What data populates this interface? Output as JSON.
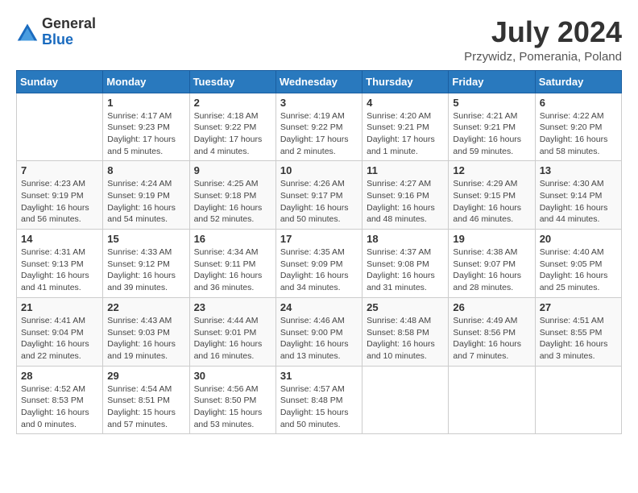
{
  "header": {
    "logo_general": "General",
    "logo_blue": "Blue",
    "month_year": "July 2024",
    "location": "Przywidz, Pomerania, Poland"
  },
  "days_of_week": [
    "Sunday",
    "Monday",
    "Tuesday",
    "Wednesday",
    "Thursday",
    "Friday",
    "Saturday"
  ],
  "weeks": [
    [
      {
        "day": "",
        "info": ""
      },
      {
        "day": "1",
        "info": "Sunrise: 4:17 AM\nSunset: 9:23 PM\nDaylight: 17 hours\nand 5 minutes."
      },
      {
        "day": "2",
        "info": "Sunrise: 4:18 AM\nSunset: 9:22 PM\nDaylight: 17 hours\nand 4 minutes."
      },
      {
        "day": "3",
        "info": "Sunrise: 4:19 AM\nSunset: 9:22 PM\nDaylight: 17 hours\nand 2 minutes."
      },
      {
        "day": "4",
        "info": "Sunrise: 4:20 AM\nSunset: 9:21 PM\nDaylight: 17 hours\nand 1 minute."
      },
      {
        "day": "5",
        "info": "Sunrise: 4:21 AM\nSunset: 9:21 PM\nDaylight: 16 hours\nand 59 minutes."
      },
      {
        "day": "6",
        "info": "Sunrise: 4:22 AM\nSunset: 9:20 PM\nDaylight: 16 hours\nand 58 minutes."
      }
    ],
    [
      {
        "day": "7",
        "info": "Sunrise: 4:23 AM\nSunset: 9:19 PM\nDaylight: 16 hours\nand 56 minutes."
      },
      {
        "day": "8",
        "info": "Sunrise: 4:24 AM\nSunset: 9:19 PM\nDaylight: 16 hours\nand 54 minutes."
      },
      {
        "day": "9",
        "info": "Sunrise: 4:25 AM\nSunset: 9:18 PM\nDaylight: 16 hours\nand 52 minutes."
      },
      {
        "day": "10",
        "info": "Sunrise: 4:26 AM\nSunset: 9:17 PM\nDaylight: 16 hours\nand 50 minutes."
      },
      {
        "day": "11",
        "info": "Sunrise: 4:27 AM\nSunset: 9:16 PM\nDaylight: 16 hours\nand 48 minutes."
      },
      {
        "day": "12",
        "info": "Sunrise: 4:29 AM\nSunset: 9:15 PM\nDaylight: 16 hours\nand 46 minutes."
      },
      {
        "day": "13",
        "info": "Sunrise: 4:30 AM\nSunset: 9:14 PM\nDaylight: 16 hours\nand 44 minutes."
      }
    ],
    [
      {
        "day": "14",
        "info": "Sunrise: 4:31 AM\nSunset: 9:13 PM\nDaylight: 16 hours\nand 41 minutes."
      },
      {
        "day": "15",
        "info": "Sunrise: 4:33 AM\nSunset: 9:12 PM\nDaylight: 16 hours\nand 39 minutes."
      },
      {
        "day": "16",
        "info": "Sunrise: 4:34 AM\nSunset: 9:11 PM\nDaylight: 16 hours\nand 36 minutes."
      },
      {
        "day": "17",
        "info": "Sunrise: 4:35 AM\nSunset: 9:09 PM\nDaylight: 16 hours\nand 34 minutes."
      },
      {
        "day": "18",
        "info": "Sunrise: 4:37 AM\nSunset: 9:08 PM\nDaylight: 16 hours\nand 31 minutes."
      },
      {
        "day": "19",
        "info": "Sunrise: 4:38 AM\nSunset: 9:07 PM\nDaylight: 16 hours\nand 28 minutes."
      },
      {
        "day": "20",
        "info": "Sunrise: 4:40 AM\nSunset: 9:05 PM\nDaylight: 16 hours\nand 25 minutes."
      }
    ],
    [
      {
        "day": "21",
        "info": "Sunrise: 4:41 AM\nSunset: 9:04 PM\nDaylight: 16 hours\nand 22 minutes."
      },
      {
        "day": "22",
        "info": "Sunrise: 4:43 AM\nSunset: 9:03 PM\nDaylight: 16 hours\nand 19 minutes."
      },
      {
        "day": "23",
        "info": "Sunrise: 4:44 AM\nSunset: 9:01 PM\nDaylight: 16 hours\nand 16 minutes."
      },
      {
        "day": "24",
        "info": "Sunrise: 4:46 AM\nSunset: 9:00 PM\nDaylight: 16 hours\nand 13 minutes."
      },
      {
        "day": "25",
        "info": "Sunrise: 4:48 AM\nSunset: 8:58 PM\nDaylight: 16 hours\nand 10 minutes."
      },
      {
        "day": "26",
        "info": "Sunrise: 4:49 AM\nSunset: 8:56 PM\nDaylight: 16 hours\nand 7 minutes."
      },
      {
        "day": "27",
        "info": "Sunrise: 4:51 AM\nSunset: 8:55 PM\nDaylight: 16 hours\nand 3 minutes."
      }
    ],
    [
      {
        "day": "28",
        "info": "Sunrise: 4:52 AM\nSunset: 8:53 PM\nDaylight: 16 hours\nand 0 minutes."
      },
      {
        "day": "29",
        "info": "Sunrise: 4:54 AM\nSunset: 8:51 PM\nDaylight: 15 hours\nand 57 minutes."
      },
      {
        "day": "30",
        "info": "Sunrise: 4:56 AM\nSunset: 8:50 PM\nDaylight: 15 hours\nand 53 minutes."
      },
      {
        "day": "31",
        "info": "Sunrise: 4:57 AM\nSunset: 8:48 PM\nDaylight: 15 hours\nand 50 minutes."
      },
      {
        "day": "",
        "info": ""
      },
      {
        "day": "",
        "info": ""
      },
      {
        "day": "",
        "info": ""
      }
    ]
  ]
}
